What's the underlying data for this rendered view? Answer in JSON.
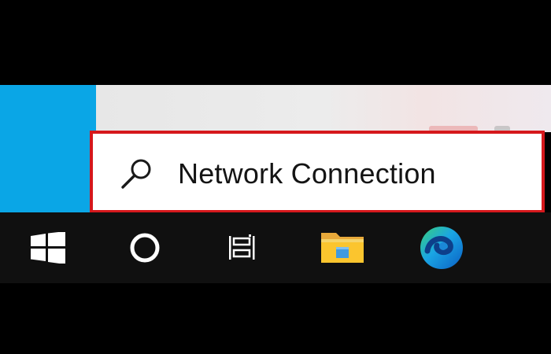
{
  "search": {
    "query": "Network Connection",
    "icon": "search-icon"
  },
  "taskbar": {
    "items": [
      {
        "name": "start-button",
        "icon": "windows-logo-icon"
      },
      {
        "name": "cortana-button",
        "icon": "cortana-ring-icon"
      },
      {
        "name": "task-view-button",
        "icon": "task-view-icon"
      },
      {
        "name": "file-explorer-button",
        "icon": "folder-icon"
      },
      {
        "name": "edge-button",
        "icon": "edge-icon"
      }
    ]
  },
  "colors": {
    "highlight_border": "#d5181c",
    "taskbar_bg": "#101010",
    "accent_tile": "#0aa6e6",
    "search_bg": "#ffffff"
  }
}
